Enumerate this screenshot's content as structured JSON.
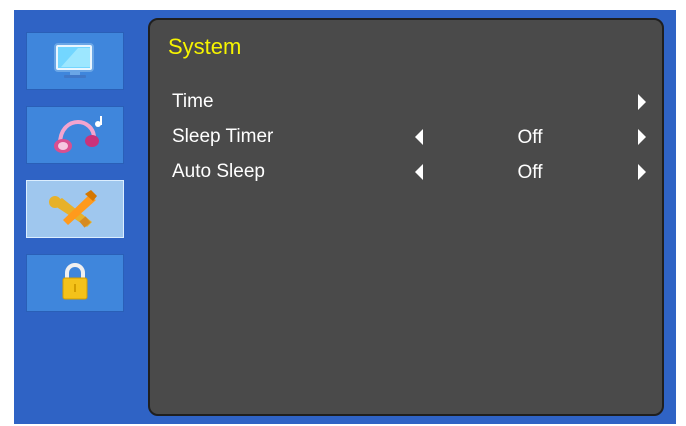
{
  "sidebar": {
    "items": [
      {
        "icon": "monitor-icon",
        "active": false
      },
      {
        "icon": "headphones-music-icon",
        "active": false
      },
      {
        "icon": "wrench-screwdriver-icon",
        "active": true
      },
      {
        "icon": "padlock-icon",
        "active": false
      }
    ]
  },
  "panel": {
    "title": "System",
    "rows": [
      {
        "label": "Time",
        "value": "",
        "has_left_arrow": false,
        "has_right_arrow": true
      },
      {
        "label": "Sleep Timer",
        "value": "Off",
        "has_left_arrow": true,
        "has_right_arrow": true
      },
      {
        "label": "Auto Sleep",
        "value": "Off",
        "has_left_arrow": true,
        "has_right_arrow": true
      }
    ]
  },
  "colors": {
    "frame": "#2f63c5",
    "panel": "#4a4a4a",
    "title": "#f6f400",
    "active_tab": "#9fc7ee"
  }
}
